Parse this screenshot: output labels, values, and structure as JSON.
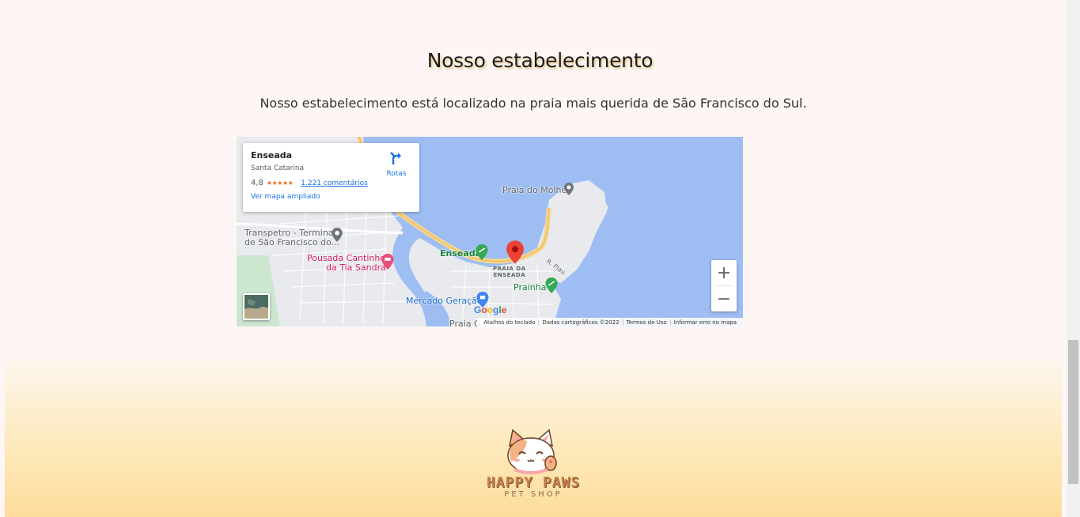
{
  "section": {
    "title": "Nosso estabelecimento",
    "subtitle": "Nosso estabelecimento está localizado na praia mais querida de São Francisco do Sul."
  },
  "map": {
    "place_card": {
      "name": "Enseada",
      "region": "Santa Catarina",
      "rating": "4,8",
      "stars": "★★★★★",
      "reviews": "1.221 comentários",
      "larger_map": "Ver mapa ampliado",
      "directions": "Rotas"
    },
    "labels": {
      "praia_do_molhe": "Praia do Molhe",
      "transpetro_line1": "Transpetro - Terminal",
      "transpetro_line2": "de São Francisco do...",
      "pousada_line1": "Pousada Cantinho",
      "pousada_line2": "da Tia Sandra",
      "enseada": "Enseada",
      "praia_da_enseada_1": "PRAIA DA",
      "praia_da_enseada_2": "ENSEADA",
      "prainha": "Prainha",
      "mercado": "Mercado Geração",
      "praia_g": "Praia G",
      "r_piau": "R. Piau"
    },
    "zoom_in": "+",
    "zoom_out": "−",
    "google": "Google",
    "attribution": [
      "Atalhos do teclado",
      "Dados cartográficos ©2022",
      "Termos de Uso",
      "Informar erro no mapa"
    ]
  },
  "footer": {
    "logo_main": "HAPPY PAWS",
    "logo_sub": "PET SHOP"
  },
  "colors": {
    "water": "#9ebef3",
    "land": "#e8eaed",
    "road": "#f6d58b",
    "accent_blue": "#1a73e8",
    "pin_red": "#ea4335"
  }
}
